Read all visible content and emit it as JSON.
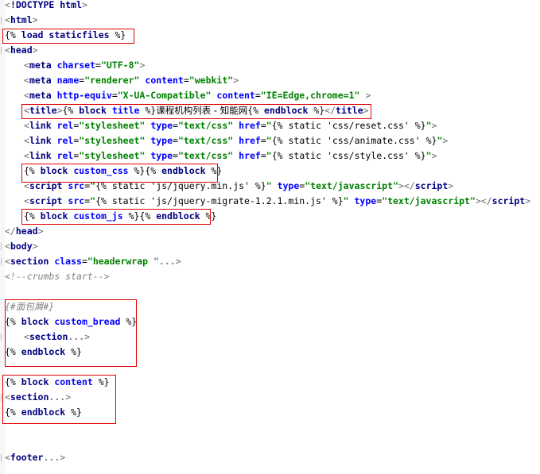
{
  "colors": {
    "tag": "#000080",
    "attr": "#0000ff",
    "string": "#008000",
    "comment": "#808080",
    "highlight_box": "#e00000"
  },
  "code_lines": [
    {
      "id": "doctype",
      "tokens": [
        [
          "br",
          "<"
        ],
        [
          "tag",
          "!DOCTYPE "
        ],
        [
          "kw",
          "html"
        ],
        [
          "br",
          ">"
        ]
      ]
    },
    {
      "id": "html-open",
      "tokens": [
        [
          "br",
          "<"
        ],
        [
          "tag",
          "html"
        ],
        [
          "br",
          ">"
        ]
      ]
    },
    {
      "id": "load-staticfiles",
      "tokens": [
        [
          "tpl",
          "{% "
        ],
        [
          "kw",
          "load staticfiles"
        ],
        [
          "tpl",
          " %}"
        ]
      ]
    },
    {
      "id": "head-open",
      "tokens": [
        [
          "br",
          "<"
        ],
        [
          "tag",
          "head"
        ],
        [
          "br",
          ">"
        ]
      ]
    },
    {
      "id": "meta-charset",
      "tokens": [
        [
          "br",
          "<"
        ],
        [
          "tag",
          "meta "
        ],
        [
          "attr",
          "charset"
        ],
        [
          "tpl",
          "="
        ],
        [
          "str",
          "\"UTF-8\""
        ],
        [
          "br",
          ">"
        ]
      ]
    },
    {
      "id": "meta-renderer",
      "tokens": [
        [
          "br",
          "<"
        ],
        [
          "tag",
          "meta "
        ],
        [
          "attr",
          "name"
        ],
        [
          "tpl",
          "="
        ],
        [
          "str",
          "\"renderer\""
        ],
        [
          "tpl",
          " "
        ],
        [
          "attr",
          "content"
        ],
        [
          "tpl",
          "="
        ],
        [
          "str",
          "\"webkit\""
        ],
        [
          "br",
          ">"
        ]
      ]
    },
    {
      "id": "meta-http-equiv",
      "tokens": [
        [
          "br",
          "<"
        ],
        [
          "tag",
          "meta "
        ],
        [
          "attr",
          "http-equiv"
        ],
        [
          "tpl",
          "="
        ],
        [
          "str",
          "\"X-UA-Compatible\""
        ],
        [
          "tpl",
          " "
        ],
        [
          "attr",
          "content"
        ],
        [
          "tpl",
          "="
        ],
        [
          "str",
          "\"IE=Edge,chrome=1\""
        ],
        [
          "tpl",
          " "
        ],
        [
          "br",
          ">"
        ]
      ]
    },
    {
      "id": "title",
      "tokens": [
        [
          "br",
          "<"
        ],
        [
          "tag",
          "title"
        ],
        [
          "br",
          ">"
        ],
        [
          "tpl",
          "{% "
        ],
        [
          "kw",
          "block "
        ],
        [
          "name",
          "title"
        ],
        [
          "tpl",
          " %}"
        ],
        [
          "cn",
          "课程机构列表 - 知能网"
        ],
        [
          "tpl",
          "{% "
        ],
        [
          "kw",
          "endblock"
        ],
        [
          "tpl",
          " %}"
        ],
        [
          "br",
          "</"
        ],
        [
          "tag",
          "title"
        ],
        [
          "br",
          ">"
        ]
      ]
    },
    {
      "id": "link-reset",
      "tokens": [
        [
          "br",
          "<"
        ],
        [
          "tag",
          "link "
        ],
        [
          "attr",
          "rel"
        ],
        [
          "tpl",
          "="
        ],
        [
          "str",
          "\"stylesheet\""
        ],
        [
          "tpl",
          " "
        ],
        [
          "attr",
          "type"
        ],
        [
          "tpl",
          "="
        ],
        [
          "str",
          "\"text/css\""
        ],
        [
          "tpl",
          " "
        ],
        [
          "attr",
          "href"
        ],
        [
          "tpl",
          "="
        ],
        [
          "str",
          "\""
        ],
        [
          "tpl",
          "{% static 'css/reset.css' %}"
        ],
        [
          "str",
          "\""
        ],
        [
          "br",
          ">"
        ]
      ]
    },
    {
      "id": "link-animate",
      "tokens": [
        [
          "br",
          "<"
        ],
        [
          "tag",
          "link "
        ],
        [
          "attr",
          "rel"
        ],
        [
          "tpl",
          "="
        ],
        [
          "str",
          "\"stylesheet\""
        ],
        [
          "tpl",
          " "
        ],
        [
          "attr",
          "type"
        ],
        [
          "tpl",
          "="
        ],
        [
          "str",
          "\"text/css\""
        ],
        [
          "tpl",
          " "
        ],
        [
          "attr",
          "href"
        ],
        [
          "tpl",
          "="
        ],
        [
          "str",
          "\""
        ],
        [
          "tpl",
          "{% static 'css/animate.css' %}"
        ],
        [
          "str",
          "\""
        ],
        [
          "br",
          ">"
        ]
      ]
    },
    {
      "id": "link-style",
      "tokens": [
        [
          "br",
          "<"
        ],
        [
          "tag",
          "link "
        ],
        [
          "attr",
          "rel"
        ],
        [
          "tpl",
          "="
        ],
        [
          "str",
          "\"stylesheet\""
        ],
        [
          "tpl",
          " "
        ],
        [
          "attr",
          "type"
        ],
        [
          "tpl",
          "="
        ],
        [
          "str",
          "\"text/css\""
        ],
        [
          "tpl",
          " "
        ],
        [
          "attr",
          "href"
        ],
        [
          "tpl",
          "="
        ],
        [
          "str",
          "\""
        ],
        [
          "tpl",
          "{% static 'css/style.css' %}"
        ],
        [
          "str",
          "\""
        ],
        [
          "br",
          ">"
        ]
      ]
    },
    {
      "id": "block-custom-css",
      "tokens": [
        [
          "tpl",
          "{% "
        ],
        [
          "kw",
          "block "
        ],
        [
          "name",
          "custom_css"
        ],
        [
          "tpl",
          " %}{% "
        ],
        [
          "kw",
          "endblock"
        ],
        [
          "tpl",
          " %}"
        ]
      ]
    },
    {
      "id": "script-jquery",
      "tokens": [
        [
          "br",
          "<"
        ],
        [
          "tag",
          "script "
        ],
        [
          "attr",
          "src"
        ],
        [
          "tpl",
          "="
        ],
        [
          "str",
          "\""
        ],
        [
          "tpl",
          "{% static 'js/jquery.min.js' %}"
        ],
        [
          "str",
          "\""
        ],
        [
          "tpl",
          " "
        ],
        [
          "attr",
          "type"
        ],
        [
          "tpl",
          "="
        ],
        [
          "str",
          "\"text/javascript\""
        ],
        [
          "br",
          ">"
        ],
        [
          "br",
          "</"
        ],
        [
          "tag",
          "script"
        ],
        [
          "br",
          ">"
        ]
      ]
    },
    {
      "id": "script-jquery-migrate",
      "tokens": [
        [
          "br",
          "<"
        ],
        [
          "tag",
          "script "
        ],
        [
          "attr",
          "src"
        ],
        [
          "tpl",
          "="
        ],
        [
          "str",
          "\""
        ],
        [
          "tpl",
          "{% static 'js/jquery-migrate-1.2.1.min.js' %}"
        ],
        [
          "str",
          "\""
        ],
        [
          "tpl",
          " "
        ],
        [
          "attr",
          "type"
        ],
        [
          "tpl",
          "="
        ],
        [
          "str",
          "\"text/javascript\""
        ],
        [
          "br",
          ">"
        ],
        [
          "br",
          "</"
        ],
        [
          "tag",
          "script"
        ],
        [
          "br",
          ">"
        ]
      ]
    },
    {
      "id": "block-custom-js",
      "tokens": [
        [
          "tpl",
          "{% "
        ],
        [
          "kw",
          "block "
        ],
        [
          "name",
          "custom_js"
        ],
        [
          "tpl",
          " %}{% "
        ],
        [
          "kw",
          "endblock"
        ],
        [
          "tpl",
          " %}"
        ]
      ]
    },
    {
      "id": "head-close",
      "tokens": [
        [
          "br",
          "</"
        ],
        [
          "tag",
          "head"
        ],
        [
          "br",
          ">"
        ]
      ]
    },
    {
      "id": "body-open",
      "tokens": [
        [
          "br",
          "<"
        ],
        [
          "tag",
          "body"
        ],
        [
          "br",
          ">"
        ]
      ]
    },
    {
      "id": "section-headerwrap",
      "tokens": [
        [
          "br",
          "<"
        ],
        [
          "tag",
          "section "
        ],
        [
          "attr",
          "class"
        ],
        [
          "tpl",
          "="
        ],
        [
          "str",
          "\"headerwrap "
        ],
        [
          "dots",
          "\"..."
        ],
        [
          "br",
          ">"
        ]
      ]
    },
    {
      "id": "comment-crumbs",
      "tokens": [
        [
          "comment",
          "<!--crumbs start-->"
        ]
      ]
    },
    {
      "id": "comment-bread",
      "tokens": [
        [
          "comment",
          "{#面包屑#}"
        ]
      ]
    },
    {
      "id": "block-custom-bread",
      "tokens": [
        [
          "tpl",
          "{% "
        ],
        [
          "kw",
          "block "
        ],
        [
          "name",
          "custom_bread"
        ],
        [
          "tpl",
          " %}"
        ]
      ]
    },
    {
      "id": "section-bread",
      "tokens": [
        [
          "br",
          "<"
        ],
        [
          "tag",
          "section"
        ],
        [
          "dots",
          "..."
        ],
        [
          "br",
          ">"
        ]
      ]
    },
    {
      "id": "endblock-bread",
      "tokens": [
        [
          "tpl",
          "{% "
        ],
        [
          "kw",
          "endblock"
        ],
        [
          "tpl",
          " %}"
        ]
      ]
    },
    {
      "id": "block-content",
      "tokens": [
        [
          "tpl",
          "{% "
        ],
        [
          "kw",
          "block "
        ],
        [
          "name",
          "content"
        ],
        [
          "tpl",
          " %}"
        ]
      ]
    },
    {
      "id": "section-content",
      "tokens": [
        [
          "br",
          "<"
        ],
        [
          "tag",
          "section"
        ],
        [
          "dots",
          "..."
        ],
        [
          "br",
          ">"
        ]
      ]
    },
    {
      "id": "endblock-content",
      "tokens": [
        [
          "tpl",
          "{% "
        ],
        [
          "kw",
          "endblock"
        ],
        [
          "tpl",
          " %}"
        ]
      ]
    },
    {
      "id": "footer",
      "tokens": [
        [
          "br",
          "<"
        ],
        [
          "tag",
          "footer"
        ],
        [
          "dots",
          "..."
        ],
        [
          "br",
          ">"
        ]
      ]
    }
  ]
}
